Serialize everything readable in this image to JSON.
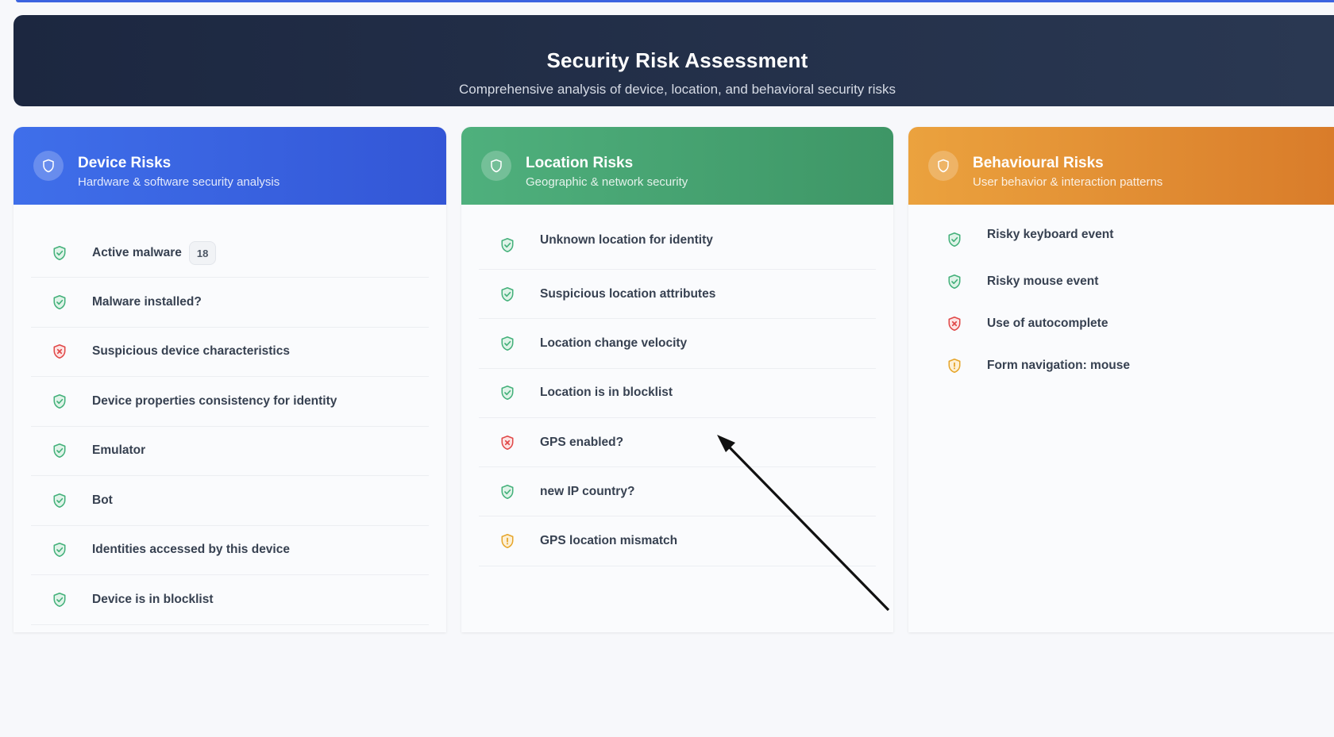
{
  "header": {
    "title": "Security Risk Assessment",
    "subtitle": "Comprehensive analysis of device, location, and behavioral security risks"
  },
  "colors": {
    "device_header": [
      "#3f6fea",
      "#3356d6"
    ],
    "location_header": [
      "#4fb07d",
      "#3e9666"
    ],
    "behavioural_header": [
      "#eba23e",
      "#d97c2a"
    ],
    "status_ok": "#43b07a",
    "status_risk": "#e04848",
    "status_warning": "#e6a52a"
  },
  "cards": {
    "device": {
      "title": "Device Risks",
      "subtitle": "Hardware & software security analysis",
      "icon": "shield-icon",
      "items": [
        {
          "label": "Active malware",
          "status": "ok",
          "icon": "shield-check-icon",
          "badge": "18"
        },
        {
          "label": "Malware installed?",
          "status": "ok",
          "icon": "shield-check-icon"
        },
        {
          "label": "Suspicious device characteristics",
          "status": "risk",
          "icon": "shield-x-icon"
        },
        {
          "label": "Device properties consistency for identity",
          "status": "ok",
          "icon": "shield-check-icon"
        },
        {
          "label": "Emulator",
          "status": "ok",
          "icon": "shield-check-icon"
        },
        {
          "label": "Bot",
          "status": "ok",
          "icon": "shield-check-icon"
        },
        {
          "label": "Identities accessed by this device",
          "status": "ok",
          "icon": "shield-check-icon"
        },
        {
          "label": "Device is in blocklist",
          "status": "ok",
          "icon": "shield-check-icon"
        }
      ]
    },
    "location": {
      "title": "Location Risks",
      "subtitle": "Geographic & network security",
      "icon": "shield-icon",
      "items": [
        {
          "label": "Unknown location for identity",
          "status": "ok",
          "icon": "shield-check-icon"
        },
        {
          "label": "Suspicious location attributes",
          "status": "ok",
          "icon": "shield-check-icon"
        },
        {
          "label": "Location change velocity",
          "status": "ok",
          "icon": "shield-check-icon"
        },
        {
          "label": "Location is in blocklist",
          "status": "ok",
          "icon": "shield-check-icon"
        },
        {
          "label": "GPS enabled?",
          "status": "risk",
          "icon": "shield-x-icon"
        },
        {
          "label": "new IP country?",
          "status": "ok",
          "icon": "shield-check-icon"
        },
        {
          "label": "GPS location mismatch",
          "status": "warning",
          "icon": "shield-alert-icon"
        }
      ]
    },
    "behavioural": {
      "title": "Behavioural Risks",
      "subtitle": "User behavior & interaction patterns",
      "icon": "shield-icon",
      "items": [
        {
          "label": "Risky keyboard event",
          "status": "ok",
          "icon": "shield-check-icon"
        },
        {
          "label": "Risky mouse event",
          "status": "ok",
          "icon": "shield-check-icon"
        },
        {
          "label": "Use of autocomplete",
          "status": "risk",
          "icon": "shield-x-icon"
        },
        {
          "label": "Form navigation: mouse",
          "status": "warning",
          "icon": "shield-alert-icon"
        }
      ]
    }
  }
}
